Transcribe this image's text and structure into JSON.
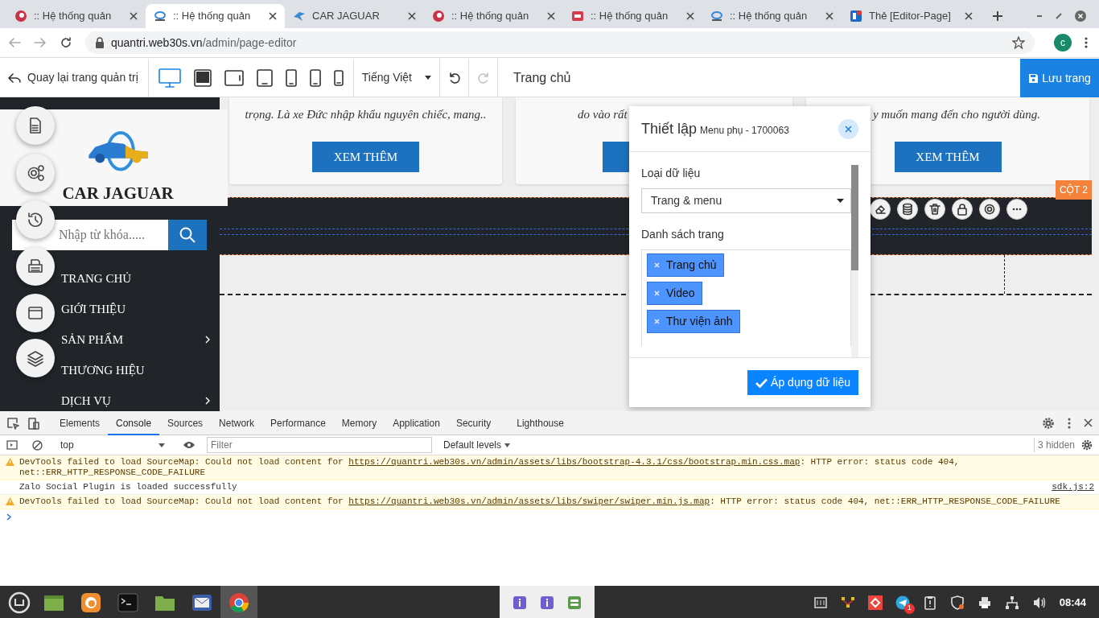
{
  "browser": {
    "tabs": [
      {
        "title": ":: Hệ thống quản",
        "kind": "swirl",
        "selected": false
      },
      {
        "title": ":: Hệ thống quản",
        "kind": "logo",
        "selected": true
      },
      {
        "title": "CAR JAGUAR",
        "kind": "bird",
        "selected": false
      },
      {
        "title": ":: Hệ thống quản",
        "kind": "swirl",
        "selected": false
      },
      {
        "title": ":: Hệ thống quản",
        "kind": "badge",
        "selected": false
      },
      {
        "title": ":: Hệ thống quản",
        "kind": "logo",
        "selected": false
      },
      {
        "title": "Thẻ [Editor-Page]",
        "kind": "doc",
        "selected": false
      }
    ],
    "address": {
      "host": "quantri.web30s.vn",
      "path": "/admin/page-editor"
    },
    "profile": "c"
  },
  "editor_toolbar": {
    "back": "Quay lại trang quản trị",
    "devices": [
      {
        "kind": "desktop",
        "selected": true
      },
      {
        "kind": "tablet-landscape",
        "selected": false
      },
      {
        "kind": "laptop",
        "selected": false
      },
      {
        "kind": "tablet",
        "selected": false
      },
      {
        "kind": "phone-large",
        "selected": false
      },
      {
        "kind": "phone",
        "selected": false
      },
      {
        "kind": "phone-small",
        "selected": false
      }
    ],
    "language": "Tiếng Việt",
    "undo": {
      "disabled": false
    },
    "redo": {
      "disabled": true
    },
    "page_title": "Trang chủ",
    "save": "Lưu trang"
  },
  "sidebar": {
    "brand": "CAR JAGUAR",
    "search": {
      "placeholder": "Nhập từ khóa....."
    },
    "menu": [
      {
        "label": "TRANG CHỦ",
        "has_submenu": false
      },
      {
        "label": "GIỚI THIỆU",
        "has_submenu": false
      },
      {
        "label": "SẢN PHẨM",
        "has_submenu": true
      },
      {
        "label": "THƯƠNG HIỆU",
        "has_submenu": false
      },
      {
        "label": "DỊCH VỤ",
        "has_submenu": true
      }
    ]
  },
  "tools": [
    {
      "kind": "page"
    },
    {
      "kind": "settings"
    },
    {
      "kind": "history"
    },
    {
      "kind": "print"
    },
    {
      "kind": "window"
    },
    {
      "kind": "layers"
    }
  ],
  "cards": [
    {
      "text": "trọng. Là xe Đức nhập khẩu nguyên chiếc, mang..",
      "button": "XEM THÊM"
    },
    {
      "text": "do vào rất"
    },
    {
      "text": "y muốn mang đến cho người dùng.",
      "button": "XEM THÊM"
    }
  ],
  "section": {
    "label": "CỘT 2",
    "actions": [
      {
        "kind": "eraser"
      },
      {
        "kind": "database"
      },
      {
        "kind": "trash"
      },
      {
        "kind": "lock"
      },
      {
        "kind": "gear"
      },
      {
        "kind": "more"
      }
    ]
  },
  "panel": {
    "title": "Thiết lập",
    "subtitle": "Menu phụ - 1700063",
    "data_type": {
      "label": "Loại dữ liệu",
      "value": "Trang & menu"
    },
    "pages": {
      "label": "Danh sách trang",
      "tags": [
        "Trang chủ",
        "Video",
        "Thư viện ảnh"
      ]
    },
    "apply": "Áp dụng dữ liệu"
  },
  "devtools": {
    "tabs": [
      {
        "label": "Elements",
        "selected": false
      },
      {
        "label": "Console",
        "selected": true
      },
      {
        "label": "Sources",
        "selected": false
      },
      {
        "label": "Network",
        "selected": false
      },
      {
        "label": "Performance",
        "selected": false
      },
      {
        "label": "Memory",
        "selected": false
      },
      {
        "label": "Application",
        "selected": false
      },
      {
        "label": "Security",
        "selected": false
      },
      {
        "label": "Lighthouse",
        "selected": false
      }
    ],
    "context": "top",
    "filter": {
      "placeholder": "Filter"
    },
    "levels": "Default levels",
    "hidden": "3 hidden",
    "messages": [
      {
        "kind": "warning",
        "before": "DevTools failed to load SourceMap: Could not load content for ",
        "link": "https://quantri.web30s.vn/admin/assets/libs/bootstrap-4.3.1/css/bootstrap.min.css.map",
        "after": ": HTTP error: status code 404, net::ERR_HTTP_RESPONSE_CODE_FAILURE"
      },
      {
        "kind": "info",
        "before": "Zalo Social Plugin is loaded successfully",
        "source": "sdk.js:2"
      },
      {
        "kind": "warning",
        "before": "DevTools failed to load SourceMap: Could not load content for ",
        "link": "https://quantri.web30s.vn/admin/assets/libs/swiper/swiper.min.js.map",
        "after": ": HTTP error: status code 404, net::ERR_HTTP_RESPONSE_CODE_FAILURE"
      }
    ]
  },
  "taskbar": {
    "apps": [
      {
        "kind": "menu",
        "selected": false
      },
      {
        "kind": "files",
        "selected": false
      },
      {
        "kind": "firefox",
        "selected": false
      },
      {
        "kind": "terminal",
        "selected": false
      },
      {
        "kind": "folder",
        "selected": false
      },
      {
        "kind": "mail",
        "selected": false
      },
      {
        "kind": "chrome",
        "selected": true
      }
    ],
    "panel_apps": [
      {
        "kind": "info"
      },
      {
        "kind": "info"
      },
      {
        "kind": "toggle"
      }
    ],
    "tray": [
      {
        "kind": "keyboard"
      },
      {
        "kind": "network-tool"
      },
      {
        "kind": "anydesk"
      },
      {
        "kind": "telegram",
        "badge": "1"
      },
      {
        "kind": "clipboard"
      },
      {
        "kind": "shield"
      },
      {
        "kind": "printer"
      },
      {
        "kind": "network"
      },
      {
        "kind": "volume"
      }
    ],
    "clock": "08:44"
  }
}
